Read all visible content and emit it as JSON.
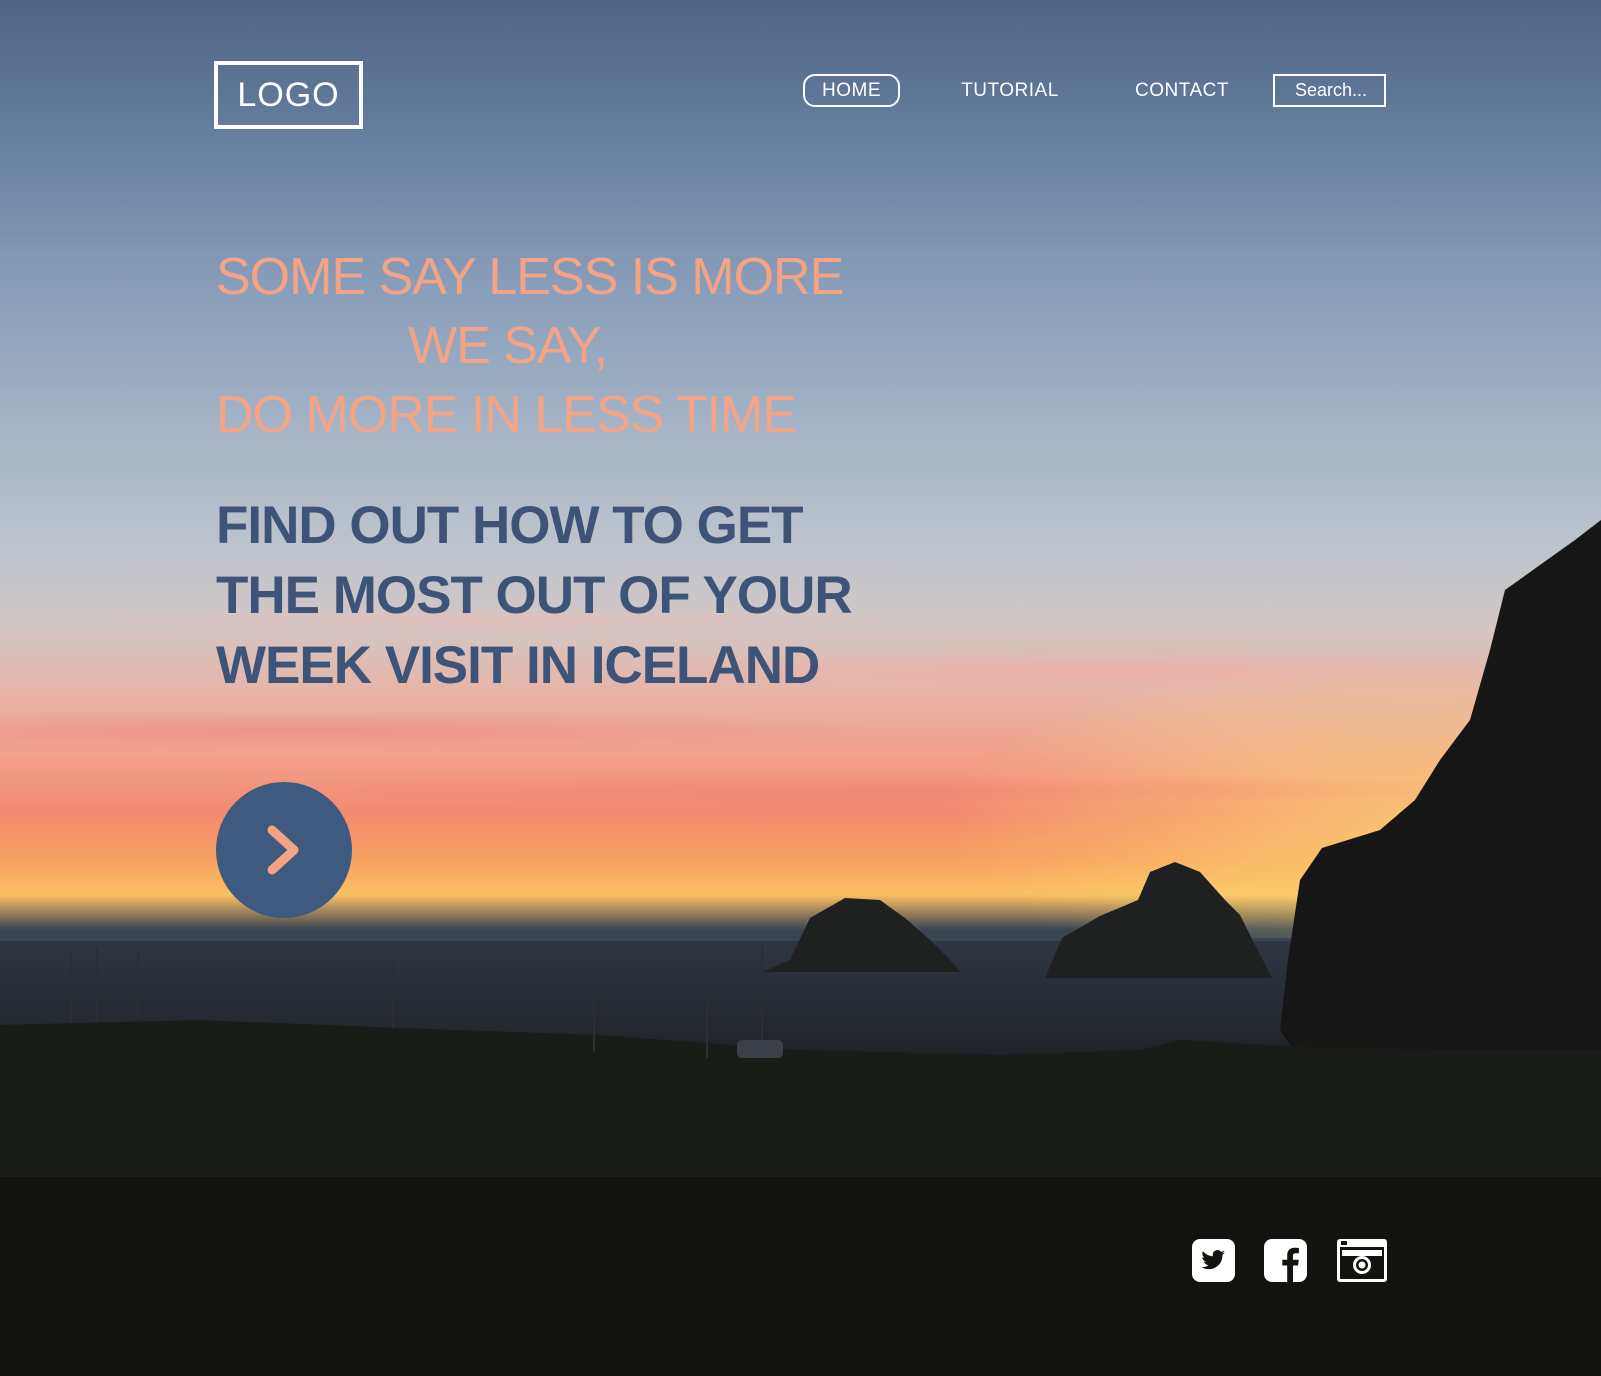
{
  "header": {
    "logo_text": "LOGO",
    "nav": [
      {
        "label": "HOME",
        "active": true
      },
      {
        "label": "TUTORIAL",
        "active": false
      },
      {
        "label": "CONTACT",
        "active": false
      }
    ],
    "search": {
      "placeholder": "Search..."
    }
  },
  "hero": {
    "tagline_lines": [
      "SOME SAY LESS IS MORE",
      "WE SAY,",
      "DO MORE IN LESS TIME"
    ],
    "subhead_lines": [
      "FIND OUT HOW TO GET",
      "THE MOST OUT OF YOUR",
      "WEEK VISIT IN ICELAND"
    ],
    "cta_icon": "chevron-right-icon"
  },
  "footer": {
    "social_icons": [
      "twitter-icon",
      "facebook-icon",
      "instagram-icon"
    ]
  },
  "colors": {
    "tagline": "#f4a484",
    "subhead": "#3d5478",
    "cta_background": "#3e5a7e",
    "cta_chevron": "#f4a484",
    "footer_background": "#12130f",
    "nav_text": "#ffffff"
  }
}
